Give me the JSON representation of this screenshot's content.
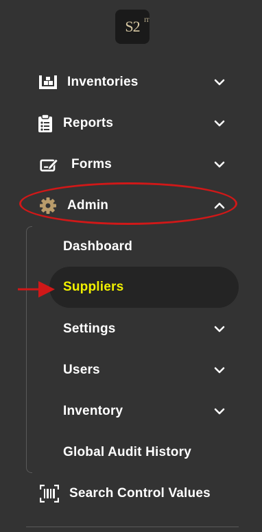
{
  "logo": {
    "text": "S2",
    "sub": "IT"
  },
  "nav": {
    "inventories": {
      "label": "Inventories",
      "icon": "warehouse-icon",
      "chevron": "chevron-down-icon"
    },
    "reports": {
      "label": "Reports",
      "icon": "clipboard-list-icon",
      "chevron": "chevron-down-icon"
    },
    "forms": {
      "label": "Forms",
      "icon": "edit-form-icon",
      "chevron": "chevron-down-icon"
    },
    "admin": {
      "label": "Admin",
      "icon": "gear-icon",
      "chevron": "chevron-up-icon",
      "expanded": true,
      "children": {
        "dashboard": {
          "label": "Dashboard"
        },
        "suppliers": {
          "label": "Suppliers",
          "selected": true
        },
        "settings": {
          "label": "Settings",
          "chevron": "chevron-down-icon"
        },
        "users": {
          "label": "Users",
          "chevron": "chevron-down-icon"
        },
        "inventory": {
          "label": "Inventory",
          "chevron": "chevron-down-icon"
        },
        "global_audit_history": {
          "label": "Global Audit History"
        }
      }
    },
    "search_control_values": {
      "label": "Search Control Values",
      "icon": "barcode-scan-icon"
    }
  },
  "colors": {
    "background": "#333333",
    "selected_bg": "#242424",
    "selected_text": "#f0f000",
    "gear_icon": "#b99c6b",
    "annotation_red": "#d01818"
  }
}
